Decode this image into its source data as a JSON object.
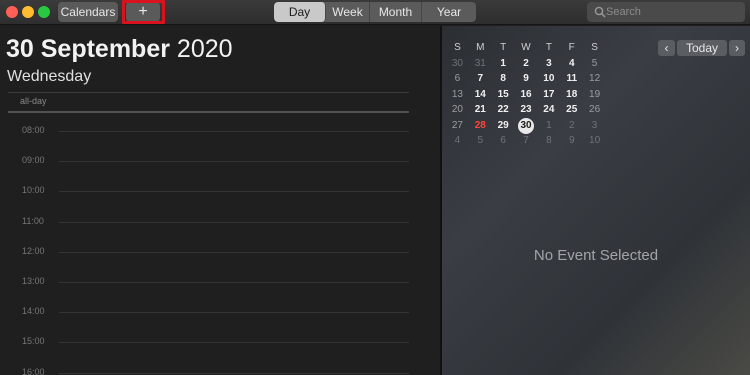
{
  "toolbar": {
    "calendars_label": "Calendars",
    "add_label": "+",
    "views": [
      "Day",
      "Week",
      "Month",
      "Year"
    ],
    "active_view": "Day",
    "search_placeholder": "Search"
  },
  "day_view": {
    "day": "30 September",
    "year": "2020",
    "weekday": "Wednesday",
    "allday_label": "all-day",
    "hours": [
      "08:00",
      "09:00",
      "10:00",
      "11:00",
      "12:00",
      "13:00",
      "14:00",
      "15:00",
      "16:00"
    ]
  },
  "mini_calendar": {
    "weekday_headers": [
      "S",
      "M",
      "T",
      "W",
      "T",
      "F",
      "S"
    ],
    "weeks": [
      [
        "30",
        "31",
        "1",
        "2",
        "3",
        "4",
        "5"
      ],
      [
        "6",
        "7",
        "8",
        "9",
        "10",
        "11",
        "12"
      ],
      [
        "13",
        "14",
        "15",
        "16",
        "17",
        "18",
        "19"
      ],
      [
        "20",
        "21",
        "22",
        "23",
        "24",
        "25",
        "26"
      ],
      [
        "27",
        "28",
        "29",
        "30",
        "1",
        "2",
        "3"
      ],
      [
        "4",
        "5",
        "6",
        "7",
        "8",
        "9",
        "10"
      ]
    ],
    "selected_date": "30",
    "today_date": "28",
    "today_label": "Today",
    "prev_label": "‹",
    "next_label": "›"
  },
  "inspector": {
    "empty_message": "No Event Selected"
  },
  "colors": {
    "highlight_box": "#d8121f",
    "today_red": "#ff4538"
  }
}
